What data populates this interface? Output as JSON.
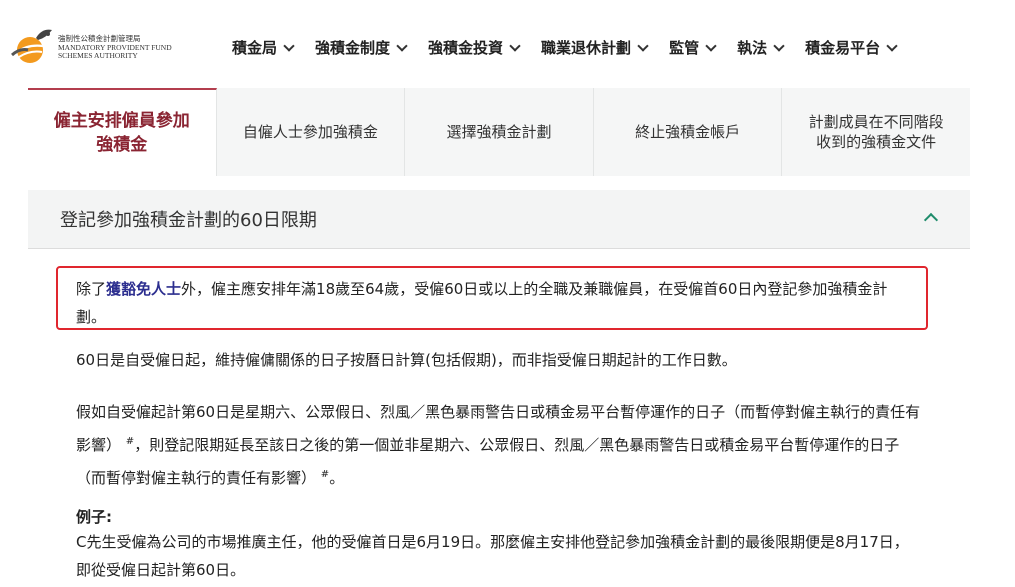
{
  "logo": {
    "chinese": "強制性公積金計劃管理局",
    "english_line1": "MANDATORY PROVIDENT FUND",
    "english_line2": "SCHEMES AUTHORITY"
  },
  "nav": [
    {
      "label": "積金局"
    },
    {
      "label": "強積金制度"
    },
    {
      "label": "強積金投資"
    },
    {
      "label": "職業退休計劃"
    },
    {
      "label": "監管"
    },
    {
      "label": "執法"
    },
    {
      "label": "積金易平台"
    }
  ],
  "tabs": [
    {
      "label": "僱主安排僱員參加強積金",
      "active": true
    },
    {
      "label": "自僱人士參加強積金",
      "active": false
    },
    {
      "label": "選擇強積金計劃",
      "active": false
    },
    {
      "label": "終止強積金帳戶",
      "active": false
    },
    {
      "label": "計劃成員在不同階段收到的強積金文件",
      "active": false
    }
  ],
  "accordion": {
    "title": "登記參加強積金計劃的60日限期",
    "expanded": true
  },
  "content": {
    "p1_pre": "除了",
    "p1_link": "獲豁免人士",
    "p1_post": "外，僱主應安排年滿18歲至64歲，受僱60日或以上的全職及兼職僱員，在受僱首60日內登記參加強積金計劃。",
    "p2": "60日是自受僱日起，維持僱傭關係的日子按曆日計算(包括假期)，而非指受僱日期起計的工作日數。",
    "p3_a": "假如自受僱起計第60日是星期六、公眾假日、烈風／黑色暴雨警告日或積金易平台暫停運作的日子（而暫停對僱主執行的責任有影響）",
    "p3_sup1": "#",
    "p3_b": "，則登記限期延長至該日之後的第一個並非星期六、公眾假日、烈風／黑色暴雨警告日或積金易平台暫停運作的日子（而暫停對僱主執行的責任有影響）",
    "p3_sup2": "#",
    "p3_c": "。",
    "example_label": "例子:",
    "p4": "C先生受僱為公司的市場推廣主任，他的受僱首日是6月19日。那麼僱主安排他登記參加強積金計劃的最後限期便是8月17日，即從受僱日起計第60日。"
  },
  "colors": {
    "active_tab_text": "#8a2432",
    "link": "#2c2e8f",
    "highlight_border": "#e0262e",
    "accordion_chevron": "#1f8c6b",
    "logo_orange": "#f39a1e"
  },
  "icons": [
    "mpf-logo-icon",
    "chevron-down-icon",
    "chevron-up-icon"
  ]
}
